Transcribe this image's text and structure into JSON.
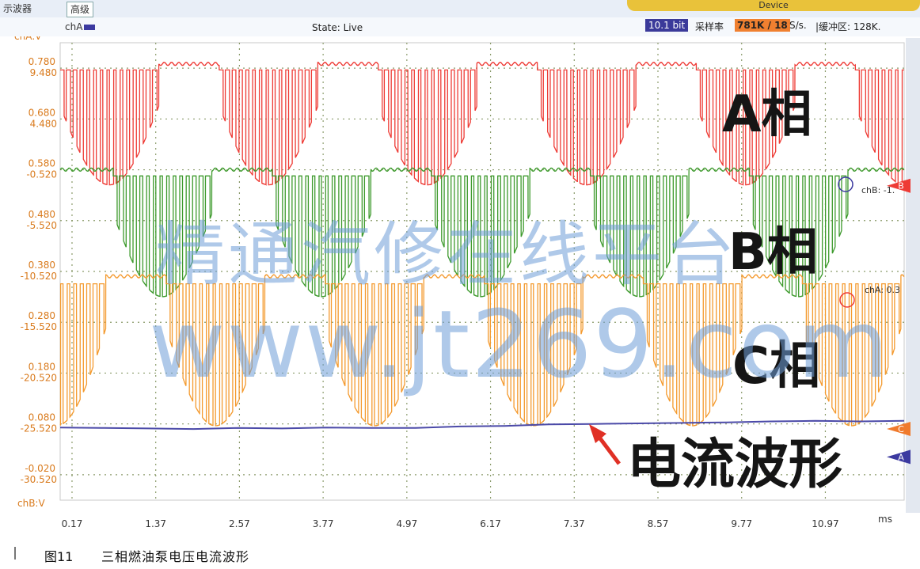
{
  "window": {
    "tab_left": "示波器",
    "tab_advanced": "高级",
    "device_label": "Device",
    "channel_button": "chA",
    "state": "State: Live",
    "bit_depth": "10.1 bit",
    "sample_rate_label": "采样率",
    "sample_rate_value": "781K / 18",
    "sample_rate_unit": "S/s.",
    "buffer": "|缓冲区: 128K."
  },
  "caption": {
    "figure_no": "图11",
    "title": "三相燃油泵电压电流波形"
  },
  "watermark": {
    "line1": "精通汽修在线平台",
    "line2": "www.jt269.com"
  },
  "chart_data": {
    "type": "line",
    "title": "",
    "left_axis_top_label": "chA:V",
    "left_axis_bottom_label": "chB:V",
    "y_ticks_chA": [
      "0.780",
      "0.680",
      "0.580",
      "0.480",
      "0.380",
      "0.280",
      "0.180",
      "0.080",
      "-0.020"
    ],
    "y_ticks_chB": [
      "9.480",
      "4.480",
      "-0.520",
      "-5.520",
      "-10.520",
      "-15.520",
      "-20.520",
      "-25.520",
      "-30.520"
    ],
    "chA_ylim": [
      -0.07,
      0.83
    ],
    "chB_ylim": [
      -33.02,
      11.98
    ],
    "x_ticks": [
      "0.17",
      "1.37",
      "2.57",
      "3.77",
      "4.97",
      "6.17",
      "7.37",
      "8.57",
      "9.77",
      "10.97"
    ],
    "x_unit": "ms",
    "xlim": [
      0.0,
      12.1
    ],
    "grid": true,
    "annotations": {
      "phase_a": "A相",
      "phase_b": "B相",
      "phase_c": "C相",
      "current": "电流波形"
    },
    "markers": {
      "b": "B",
      "c": "C",
      "a": "A",
      "chB_ref": "chB: -1.",
      "chA_ref": "chA: 0.3"
    },
    "series": [
      {
        "key": "phase_a",
        "color": "#ee3b35",
        "high": 9.9,
        "low": -2.0,
        "period": 2.28,
        "offset": 0.0
      },
      {
        "key": "phase_b",
        "color": "#3d9a2c",
        "high": -0.5,
        "low": -13.0,
        "period": 2.28,
        "offset": 0.76
      },
      {
        "key": "phase_c",
        "color": "#f49a2e",
        "high": -11.0,
        "low": -25.7,
        "period": 2.28,
        "offset": 1.52
      },
      {
        "key": "current",
        "color": "#4b4aa8",
        "values": [
          0.073,
          0.072,
          0.071,
          0.07,
          0.072,
          0.071,
          0.073,
          0.072,
          0.072,
          0.075,
          0.076,
          0.079,
          0.08,
          0.081,
          0.082,
          0.083,
          0.085,
          0.086,
          0.085,
          0.086
        ]
      }
    ]
  }
}
